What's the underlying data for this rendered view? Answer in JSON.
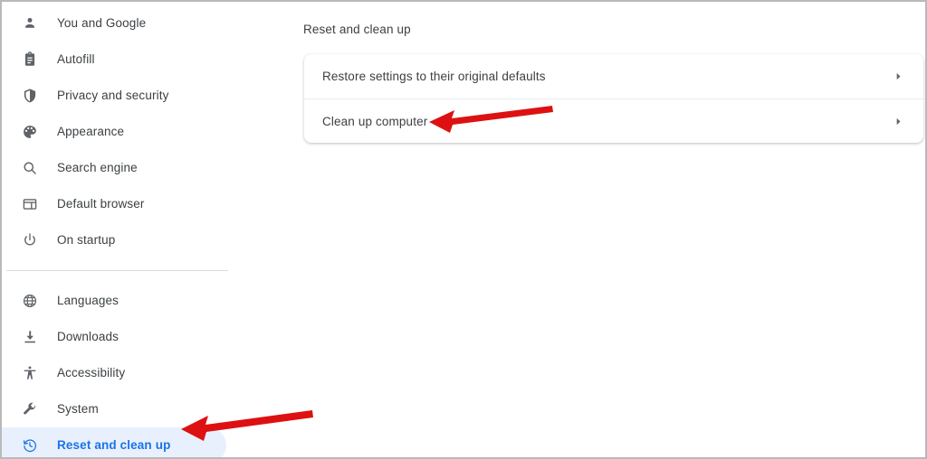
{
  "app": {
    "name": "Chrome Settings",
    "accent_color": "#1a73e8",
    "selected_pill_color": "#e8f0fe",
    "text_color": "#3c4043",
    "icon_color": "#5f6368",
    "annotation_color": "#dd1111"
  },
  "sidebar": {
    "groups": [
      {
        "items": [
          {
            "label": "You and Google",
            "icon": "person-icon",
            "selected": false
          },
          {
            "label": "Autofill",
            "icon": "clipboard-icon",
            "selected": false
          },
          {
            "label": "Privacy and security",
            "icon": "shield-icon",
            "selected": false
          },
          {
            "label": "Appearance",
            "icon": "palette-icon",
            "selected": false
          },
          {
            "label": "Search engine",
            "icon": "search-icon",
            "selected": false
          },
          {
            "label": "Default browser",
            "icon": "browser-window-icon",
            "selected": false
          },
          {
            "label": "On startup",
            "icon": "power-icon",
            "selected": false
          }
        ]
      },
      {
        "items": [
          {
            "label": "Languages",
            "icon": "globe-icon",
            "selected": false
          },
          {
            "label": "Downloads",
            "icon": "download-icon",
            "selected": false
          },
          {
            "label": "Accessibility",
            "icon": "accessibility-icon",
            "selected": false
          },
          {
            "label": "System",
            "icon": "wrench-icon",
            "selected": false
          },
          {
            "label": "Reset and clean up",
            "icon": "history-restore-icon",
            "selected": true
          }
        ]
      }
    ]
  },
  "main": {
    "section_title": "Reset and clean up",
    "card_rows": [
      {
        "label": "Restore settings to their original defaults",
        "chevron": "chevron-right-icon"
      },
      {
        "label": "Clean up computer",
        "chevron": "chevron-right-icon"
      }
    ]
  },
  "annotations": [
    {
      "name": "arrow-pointing-to-clean-up-computer",
      "shape": "left-arrow",
      "color": "#dd1111"
    },
    {
      "name": "arrow-pointing-to-reset-and-clean-up",
      "shape": "left-arrow",
      "color": "#dd1111"
    }
  ]
}
